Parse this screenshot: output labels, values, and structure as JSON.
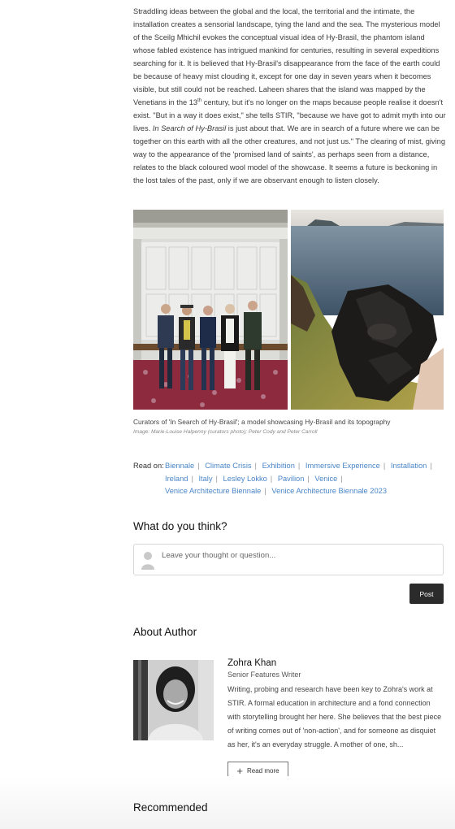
{
  "article": {
    "p1": "Straddling ideas between the global and the local, the territorial and the intimate, the installation creates a sensorial landscape, tying the land and the sea. The mysterious model of the Sceilg Mhichil evokes the conceptual visual idea of Hy-Brasil, the phantom island whose fabled existence has intrigued mankind for centuries, resulting in several expeditions searching for it. It is believed that Hy-Brasil's disappearance from the face of the earth could be because of heavy mist clouding it, except for one day in seven years when it becomes visible, but still could not be reached. Laheen shares that the island was mapped by the Venetians in the 13",
    "sup": "th",
    "p2": " century, but it's no longer on the maps because people realise it doesn't exist. \"But in a way it does exist,\" she tells STIR, \"because we have got to admit myth into our lives. ",
    "em": "In Search of Hy-Brasil",
    "p3": " is just about that. We are in search of a future where we can be together on this earth with all the other creatures, and not just us.\" The clearing of mist, giving way to the appearance of the 'promised land of saints', as perhaps seen from a distance, relates to the black coloured wool model of the showcase. It seems a future is beckoning in the lost tales of the past, only if we are observant enough to listen closely."
  },
  "figure": {
    "caption": "Curators of 'In Search of Hy-Brasil'; a model showcasing Hy-Brasil and its topography",
    "credit": "Image: Marie-Louise Halpenny (curators photo); Peter Cody and Peter Carroll"
  },
  "tags": {
    "label": "Read on:",
    "items": [
      "Biennale",
      "Climate Crisis",
      "Exhibition",
      "Immersive Experience",
      "Installation",
      "Ireland",
      "Italy",
      "Lesley Lokko",
      "Pavilion",
      "Venice",
      "Venice Architecture Biennale",
      "Venice Architecture Biennale 2023"
    ],
    "separator": "|"
  },
  "comments": {
    "heading": "What do you think?",
    "placeholder": "Leave your thought or question...",
    "post_label": "Post"
  },
  "author": {
    "heading": "About Author",
    "name": "Zohra Khan",
    "role": "Senior Features Writer",
    "bio": "Writing, probing and research have been key to Zohra's work at STIR. A formal education in architecture and a fond connection with storytelling brought her here. She believes that the best piece of writing comes out of 'non-action', and for someone as disquiet as her, it's an everyday struggle. A mother of one, sh...",
    "read_more": "Read more"
  },
  "recommended": {
    "heading": "Recommended"
  },
  "colors": {
    "link": "#4a86c8",
    "button_dark": "#2b2b2b"
  }
}
